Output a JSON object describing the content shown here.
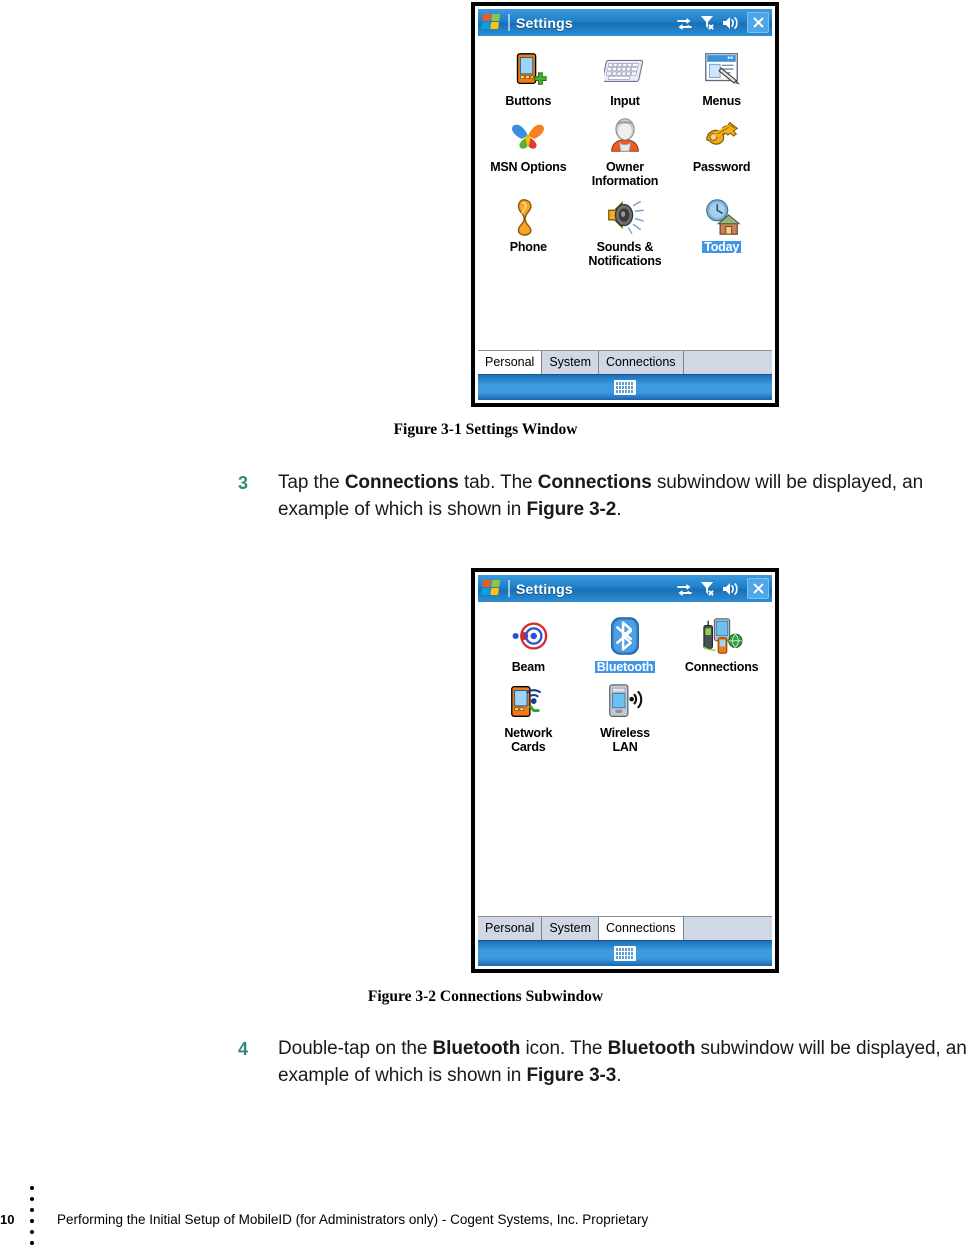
{
  "page": {
    "number": "10",
    "footer_text": "Performing the Initial Setup of MobileID (for Administrators only)  - Cogent Systems, Inc. Proprietary",
    "footer_dot_count": 6,
    "accent_color": "#2f8a7c",
    "selection_color": "#3d95e8",
    "titlebar_color": "#1f7fc8"
  },
  "figure1": {
    "caption": "Figure 3-1 Settings Window",
    "device": {
      "title": "Settings",
      "titlebar_icons": [
        "connectivity-icon",
        "signal-off-icon",
        "volume-icon",
        "close-icon"
      ],
      "icons": [
        {
          "label": "Buttons",
          "art": "pda-buttons-icon",
          "selected": false
        },
        {
          "label": "Input",
          "art": "keyboard-icon",
          "selected": false
        },
        {
          "label": "Menus",
          "art": "menus-window-icon",
          "selected": false
        },
        {
          "label": "MSN Options",
          "art": "msn-butterfly-icon",
          "selected": false
        },
        {
          "label": "Owner\nInformation",
          "art": "owner-person-icon",
          "selected": false
        },
        {
          "label": "Password",
          "art": "password-key-icon",
          "selected": false
        },
        {
          "label": "Phone",
          "art": "phone-handset-icon",
          "selected": false
        },
        {
          "label": "Sounds &\nNotifications",
          "art": "speaker-sound-icon",
          "selected": false
        },
        {
          "label": "Today",
          "art": "today-clock-house-icon",
          "selected": true
        }
      ],
      "tabs": [
        {
          "label": "Personal",
          "active": true
        },
        {
          "label": "System",
          "active": false
        },
        {
          "label": "Connections",
          "active": false
        }
      ],
      "sip": "keyboard-sip-icon"
    }
  },
  "figure2": {
    "caption": "Figure 3-2 Connections Subwindow",
    "device": {
      "title": "Settings",
      "titlebar_icons": [
        "connectivity-icon",
        "signal-off-icon",
        "volume-icon",
        "close-icon"
      ],
      "icons": [
        {
          "label": "Beam",
          "art": "beam-target-icon",
          "selected": false
        },
        {
          "label": "Bluetooth",
          "art": "bluetooth-icon",
          "selected": true
        },
        {
          "label": "Connections",
          "art": "connections-devices-icon",
          "selected": false
        },
        {
          "label": "Network\nCards",
          "art": "network-card-icon",
          "selected": false
        },
        {
          "label": "Wireless\nLAN",
          "art": "wireless-lan-icon",
          "selected": false
        }
      ],
      "tabs": [
        {
          "label": "Personal",
          "active": false
        },
        {
          "label": "System",
          "active": false
        },
        {
          "label": "Connections",
          "active": true
        }
      ],
      "sip": "keyboard-sip-icon"
    }
  },
  "steps": [
    {
      "number": "3",
      "parts": [
        {
          "t": "Tap the ",
          "b": false
        },
        {
          "t": "Connections",
          "b": true
        },
        {
          "t": " tab. The ",
          "b": false
        },
        {
          "t": "Connections",
          "b": true
        },
        {
          "t": " subwindow will be displayed, an example of which is shown in ",
          "b": false
        },
        {
          "t": "Figure 3-2",
          "b": true
        },
        {
          "t": ".",
          "b": false
        }
      ]
    },
    {
      "number": "4",
      "parts": [
        {
          "t": "Double-tap on the ",
          "b": false
        },
        {
          "t": "Bluetooth",
          "b": true
        },
        {
          "t": " icon. The ",
          "b": false
        },
        {
          "t": "Bluetooth",
          "b": true
        },
        {
          "t": " subwindow will be displayed, an example of which is shown in ",
          "b": false
        },
        {
          "t": "Figure 3-3",
          "b": true
        },
        {
          "t": ".",
          "b": false
        }
      ]
    }
  ]
}
